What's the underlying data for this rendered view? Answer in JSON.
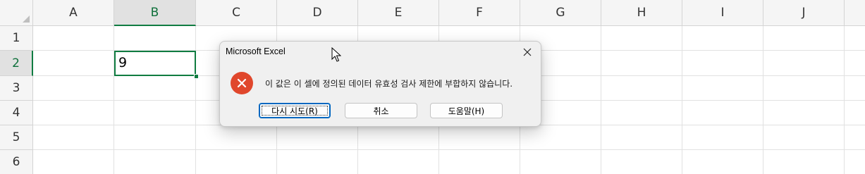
{
  "columns": [
    "A",
    "B",
    "C",
    "D",
    "E",
    "F",
    "G",
    "H",
    "I",
    "J"
  ],
  "rows": [
    "1",
    "2",
    "3",
    "4",
    "5",
    "6"
  ],
  "selected_column": "B",
  "selected_row": "2",
  "active_cell": {
    "address": "B2",
    "value": "9"
  },
  "dialog": {
    "title": "Microsoft Excel",
    "icon": "error-icon",
    "message": "이 값은 이 셀에 정의된 데이터 유효성 검사 제한에 부합하지 않습니다.",
    "buttons": {
      "retry": "다시 시도(R)",
      "cancel": "취소",
      "help": "도움말(H)"
    }
  },
  "colors": {
    "accent": "#107c41",
    "error": "#e0472c",
    "focus": "#0067c0"
  }
}
